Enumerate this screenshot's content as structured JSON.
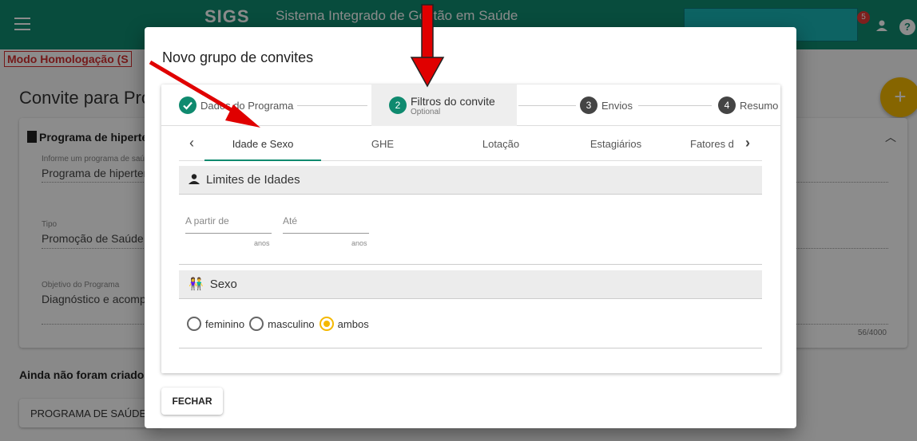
{
  "app": {
    "logo_text": "SIGS",
    "title": "Sistema Integrado de Gestão em Saúde",
    "notifications_count": "5",
    "help_glyph": "?"
  },
  "background": {
    "mode_banner": "Modo Homologação (S",
    "page_title": "Convite para Pro",
    "card": {
      "program_heading": "Programa de hipertens",
      "program_label": "Informe um programa de saú",
      "program_value": "Programa de hipertens",
      "tipo_label": "Tipo",
      "tipo_value": "Promoção de Saúde",
      "objetivo_label": "Objetivo do Programa",
      "objetivo_value": "Diagnóstico e acompa",
      "char_counter": "56/4000"
    },
    "not_created_text": "Ainda não foram criados",
    "program_button": "PROGRAMA DE SAÚDE",
    "fab_label": "+"
  },
  "dialog": {
    "title": "Novo grupo de convites",
    "steps": [
      {
        "number": "✓",
        "label": "Dados do Programa",
        "state": "done"
      },
      {
        "number": "2",
        "label": "Filtros do convite",
        "sublabel": "Optional",
        "state": "active"
      },
      {
        "number": "3",
        "label": "Envios",
        "state": "pending"
      },
      {
        "number": "4",
        "label": "Resumo",
        "state": "pending"
      }
    ],
    "tabs": [
      "Idade e Sexo",
      "GHE",
      "Lotação",
      "Estagiários",
      "Fatores d"
    ],
    "age_section": {
      "header": "Limites de Idades",
      "from_label": "A partir de",
      "to_label": "Até",
      "unit": "anos"
    },
    "sex_section": {
      "header": "Sexo",
      "options": [
        "feminino",
        "masculino",
        "ambos"
      ],
      "selected": "ambos"
    },
    "close_button": "FECHAR"
  },
  "colors": {
    "primary": "#0f8a6f",
    "accent": "#f5b800",
    "annotation_arrow": "#e00000"
  },
  "icons": [
    "menu-icon",
    "person-icon",
    "help-icon",
    "check-icon",
    "chevron-left-icon",
    "chevron-right-icon",
    "document-icon",
    "people-icon",
    "chevron-up-icon"
  ]
}
